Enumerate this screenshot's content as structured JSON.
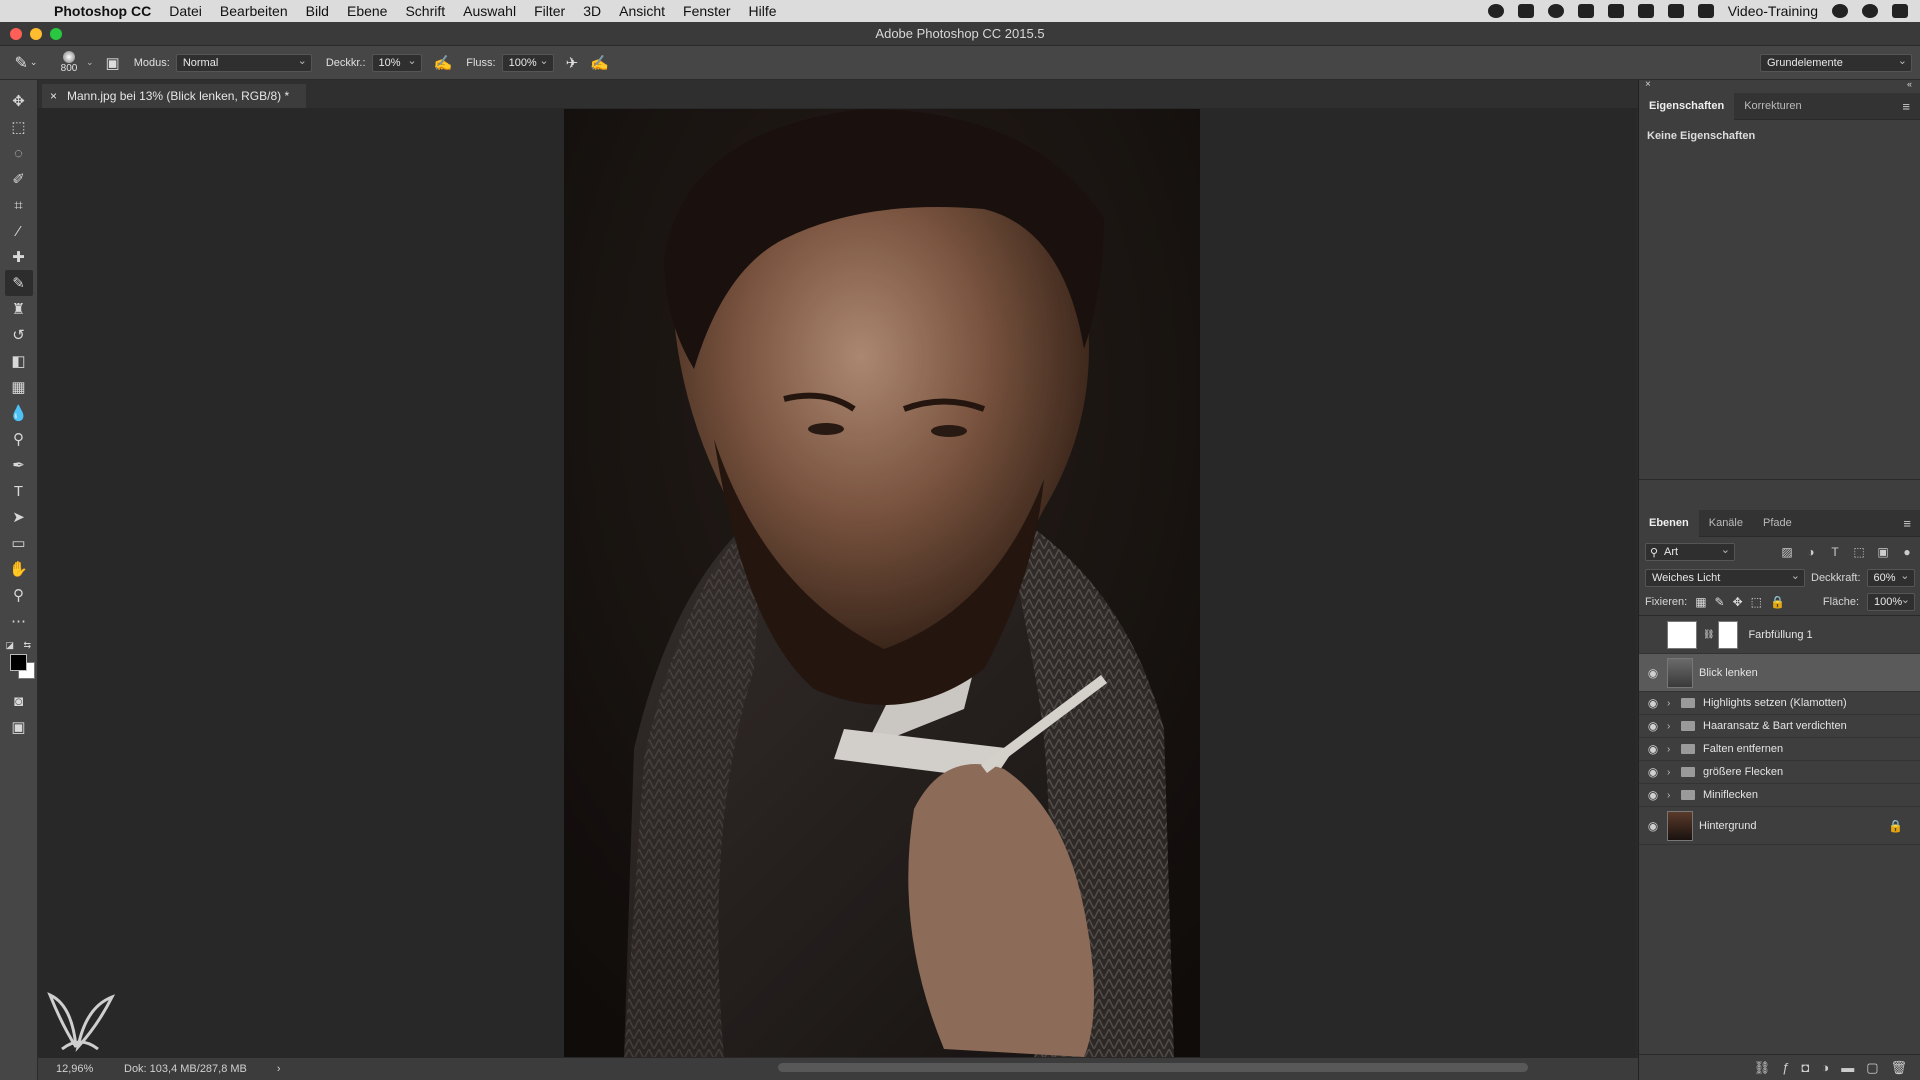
{
  "menubar": {
    "app_name": "Photoshop CC",
    "items": [
      "Datei",
      "Bearbeiten",
      "Bild",
      "Ebene",
      "Schrift",
      "Auswahl",
      "Filter",
      "3D",
      "Ansicht",
      "Fenster",
      "Hilfe"
    ],
    "user": "Video-Training"
  },
  "window": {
    "title": "Adobe Photoshop CC 2015.5"
  },
  "options": {
    "brush_size": "800",
    "mode_label": "Modus:",
    "mode_value": "Normal",
    "opacity_label": "Deckkr.:",
    "opacity_value": "10%",
    "flow_label": "Fluss:",
    "flow_value": "100%",
    "workspace": "Grundelemente"
  },
  "document": {
    "tab_title": "Mann.jpg bei 13% (Blick lenken, RGB/8) *",
    "zoom": "12,96%",
    "doc_size": "Dok: 103,4 MB/287,8 MB"
  },
  "properties": {
    "tabs": [
      "Eigenschaften",
      "Korrekturen"
    ],
    "empty_text": "Keine Eigenschaften"
  },
  "layers": {
    "tabs": [
      "Ebenen",
      "Kanäle",
      "Pfade"
    ],
    "kind_filter": "Art",
    "blend_mode": "Weiches Licht",
    "opacity_label": "Deckkraft:",
    "opacity_value": "60%",
    "lock_label": "Fixieren:",
    "fill_label": "Fläche:",
    "fill_value": "100%",
    "items": [
      {
        "name": "Farbfüllung 1"
      },
      {
        "name": "Blick lenken"
      },
      {
        "name": "Highlights setzen (Klamotten)"
      },
      {
        "name": "Haaransatz & Bart verdichten"
      },
      {
        "name": "Falten entfernen"
      },
      {
        "name": "größere Flecken"
      },
      {
        "name": "Miniflecken"
      },
      {
        "name": "Hintergrund"
      }
    ]
  },
  "colors": {
    "close": "#ff5f57",
    "minimize": "#febc2e",
    "maximize": "#28c840"
  }
}
